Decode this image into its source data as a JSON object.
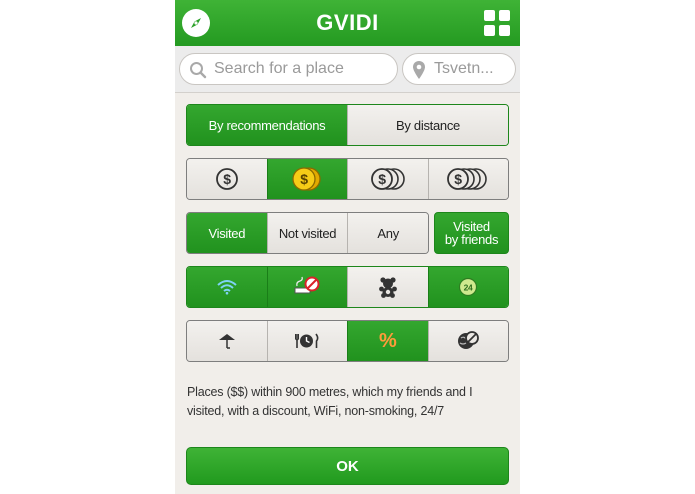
{
  "app": {
    "title": "GVIDI",
    "left_icon": "compass-icon",
    "right_icon": "grid-menu-icon"
  },
  "search": {
    "placeholder": "Search for a place",
    "location": "Tsvetn..."
  },
  "sort": {
    "options": [
      "By recommendations",
      "By distance"
    ],
    "selected": "By recommendations"
  },
  "price": {
    "icons": [
      "one-coin-icon",
      "two-coins-icon",
      "three-coins-icon",
      "four-coins-icon"
    ],
    "selected_index": 1,
    "symbol": "$"
  },
  "visited": {
    "options": [
      "Visited",
      "Not visited",
      "Any"
    ],
    "selected": "Visited",
    "friends_line1": "Visited",
    "friends_line2": "by friends",
    "friends_selected": true
  },
  "amenities": {
    "icons": [
      "wifi-icon",
      "no-smoking-icon",
      "kids-teddy-bear-icon",
      "open-24h-icon"
    ],
    "selected": [
      true,
      true,
      false,
      true
    ],
    "badge_24": "24"
  },
  "features": {
    "icons": [
      "terrace-umbrella-icon",
      "business-lunch-icon",
      "discount-icon",
      "no-pets-icon"
    ],
    "selected": [
      false,
      false,
      true,
      false
    ],
    "discount_symbol": "%"
  },
  "summary": {
    "text": "Places ($$) within 900 metres, which my friends and I visited, with a discount, WiFi, non-smoking, 24/7"
  },
  "ok_button": {
    "label": "OK"
  },
  "colors": {
    "accent": "#2aa027",
    "accent_dark": "#1d861b",
    "background": "#f1eeea",
    "coin_gold": "#f2c200"
  }
}
